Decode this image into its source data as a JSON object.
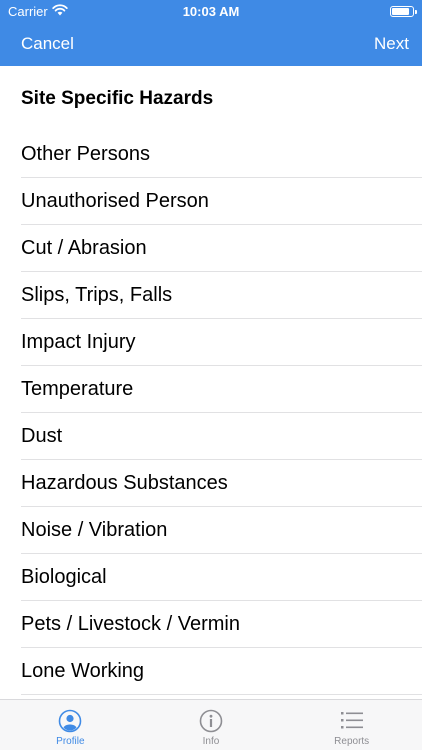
{
  "status_bar": {
    "carrier": "Carrier",
    "time": "10:03 AM",
    "icons": [
      "wifi-icon",
      "battery-icon"
    ]
  },
  "nav": {
    "cancel": "Cancel",
    "next": "Next",
    "bar_color": "#3f8ae5"
  },
  "section_title": "Site Specific Hazards",
  "hazards": [
    "Other Persons",
    "Unauthorised Person",
    "Cut / Abrasion",
    "Slips, Trips, Falls",
    "Impact Injury",
    "Temperature",
    "Dust",
    "Hazardous Substances",
    "Noise / Vibration",
    "Biological",
    "Pets / Livestock / Vermin",
    "Lone Working"
  ],
  "tabs": [
    {
      "label": "Profile",
      "icon": "profile-icon",
      "active": true
    },
    {
      "label": "Info",
      "icon": "info-icon",
      "active": false
    },
    {
      "label": "Reports",
      "icon": "list-icon",
      "active": false
    }
  ],
  "colors": {
    "accent": "#3f8ae5",
    "inactive": "#8e8e93"
  }
}
